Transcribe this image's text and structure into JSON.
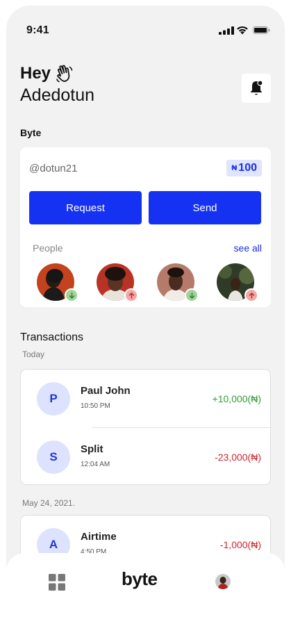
{
  "status_bar": {
    "time": "9:41"
  },
  "header": {
    "greeting": "Hey",
    "user_name": "Adedotun"
  },
  "byte_section": {
    "title": "Byte",
    "handle": "@dotun21",
    "currency_symbol": "₦",
    "balance": "100",
    "request_label": "Request",
    "send_label": "Send",
    "people_label": "People",
    "see_all_label": "see all",
    "people": [
      {
        "direction": "received",
        "badge_icon": "arrow-down-icon"
      },
      {
        "direction": "sent",
        "badge_icon": "arrow-up-icon"
      },
      {
        "direction": "received",
        "badge_icon": "arrow-down-icon"
      },
      {
        "direction": "sent",
        "badge_icon": "arrow-up-icon"
      }
    ]
  },
  "transactions": {
    "title": "Transactions",
    "groups": [
      {
        "date": "Today",
        "items": [
          {
            "initial": "P",
            "name": "Paul John",
            "time": "10:50 PM",
            "amount": "+10,000(₦)",
            "type": "credit"
          },
          {
            "initial": "S",
            "name": "Split",
            "time": "12:04 AM",
            "amount": "-23,000(₦)",
            "type": "debit"
          }
        ]
      },
      {
        "date": "May 24, 2021.",
        "items": [
          {
            "initial": "A",
            "name": "Airtime",
            "time": "4:50 PM",
            "amount": "-1,000(₦)",
            "type": "debit"
          }
        ]
      }
    ]
  },
  "bottom_nav": {
    "logo": "byte"
  },
  "colors": {
    "accent": "#1531f2",
    "accent_light": "#dde3ff",
    "credit": "#2e9e33",
    "debit": "#d1242f",
    "background": "#f2f2f2"
  }
}
